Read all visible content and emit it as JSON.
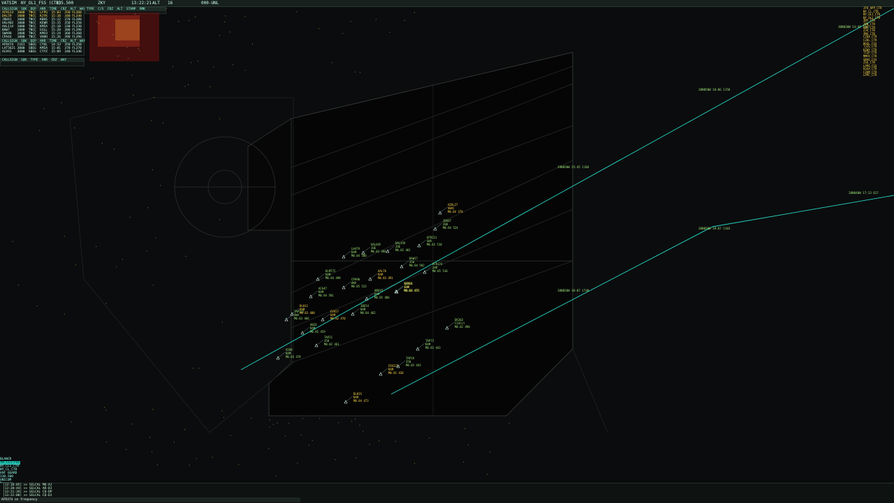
{
  "topbar": {
    "menu": "VATSIM",
    "profile": "NY_OL1_FSS (CTR)",
    "frequency": "135.500",
    "airport": "ZKY",
    "clock": "13:22:21",
    "range": "16",
    "vis": "000-UNL",
    "alt": "ALT"
  },
  "panels": {
    "departures": {
      "title": "CALLSIGN  SQK  DEP  ARR  TIME  CRZ  ALT  WAY",
      "rows": [
        "AFR123  1000  TNCC  LFPG  15:03  350 FL360",
        "DAL59   1000  TNCC  KJFK  15:10  340 FL340",
        "JBU41   1000  TNCC  KBOS  15:12  370 FL380",
        "UAL902  1000  TNCC  KEWR  15:15  350 FL350",
        "AAL114  1000  TNCC  KMIA  15:18  330 FL330",
        "BAW7    1000  TNCC  EGLL  15:20  380 FL390",
        "SWA88   1000  TNCC  KMCO  15:24  360 FL360",
        "CPA44   1000  TNCC  VHHH  15:26  390 FL390"
      ]
    },
    "arrivals": {
      "title": "CALLSIGN  SQK  DEP  ARR  TIME  CRZ  ALT  WAY",
      "rows": [
        "AFR474  2161  SBEG  CYUL  14:33  350 FL350",
        "LAT5621 3000  SBEG  KMIA  15:01  370 FL370",
        "ACA91   3000  SBEG  CYYZ  15:09  340 FL340"
      ]
    },
    "sector": {
      "title": "CALLSIGN  SQK  TYPE  ARR  CRZ  WAY",
      "rows": []
    },
    "metar": {
      "title": "TYPE  C/S  CRZ  ALT  STAMP  RMK",
      "rows": []
    }
  },
  "status": {
    "line1": "BLANCR",
    "line2": "NY_CL1_FSS",
    "line3": "NY_CL1_CTR",
    "line4": "NY_CL_CTR",
    "line5": "VHF GUARD",
    "line6": "130.500",
    "line7": "UNICOM",
    "line8": "Message"
  },
  "chat": {
    "lines": [
      "[13:18:05] >> SELCAL MQ-AJ",
      "[13:20:44] >> SELCAL AK-DJ",
      "[13:21:34] >> SELCAL CQ-DP",
      "[13:22:00] >> SELCAL CQ-DJ"
    ],
    "input": "AFR374 on frequency"
  },
  "freqlist": [
    "JFK_APP_CTR",
    "NY_CL_CTR",
    "NY_OL1_CTR",
    "NY_OL2_CTR",
    "ZNY_CTR",
    "ZBW_CTR",
    "ZDC_CTR",
    "ZJX_CTR",
    "ZMA_CTR",
    "CZQX_CTR",
    "CZUL_CTR",
    "BGGL_FSS",
    "TJZS_CTR",
    "KZWY_CTR",
    "TTZP_CTR",
    "MMFR_CTR",
    "SBAO_FSS",
    "ZSU_CTR",
    "LPPO_FSS",
    "EGGX_CTR",
    "CZQM_CTR",
    "LPPC_CTR"
  ],
  "waypoints": {
    "wp1": "20N050W 18:06 1158",
    "wp2": "19N050W 15:45 1184",
    "wp3": "18N050W 18:07 1748",
    "wp4": "20N050W 18:07 2103",
    "wp5": "20N040W 17:13 627",
    "wp6": "30N030W 14:49 1167"
  },
  "targets": [
    {
      "cs": "AZAL27",
      "info": "VWXC",
      "alt": "M0.84 378",
      "col": "#ffd84a"
    },
    {
      "cs": "AFR211",
      "info": "SWX",
      "alt": "M0.83 510",
      "col": "#9fe67a"
    },
    {
      "cs": "JBU87",
      "info": "Z00",
      "alt": "M0.84 524",
      "col": "#9fe67a"
    },
    {
      "cs": "AFR374",
      "info": "348",
      "alt": "M0.85 510",
      "col": "#9fe67a"
    },
    {
      "cs": "DAL459",
      "info": "JOE",
      "alt": "M0.82 481",
      "col": "#9fe67a"
    },
    {
      "cs": "BAW17",
      "info": "350",
      "alt": "M0.84 502",
      "col": "#9fe67a"
    },
    {
      "cs": "UAL845",
      "info": "JOE",
      "alt": "M0.83 498",
      "col": "#9fe67a"
    },
    {
      "cs": "LH479",
      "info": "RAM",
      "alt": "M0.84 500",
      "col": "#9fe67a"
    },
    {
      "cs": "AAL76",
      "info": "RAM",
      "alt": "M0.83 491",
      "col": "#ffd84a"
    },
    {
      "cs": "CPA90",
      "info": "OWX",
      "alt": "M0.85 533",
      "col": "#9fe67a"
    },
    {
      "cs": "SWA14",
      "info": "JUX",
      "alt": "M0.82 477",
      "col": "#9fe67a"
    },
    {
      "cs": "KLM772",
      "info": "RAM",
      "alt": "M0.84 498",
      "col": "#9fe67a"
    },
    {
      "cs": "DLH11",
      "info": "RAM",
      "alt": "M0.83 480",
      "col": "#ffd84a"
    },
    {
      "cs": "ACA47",
      "info": "RAM",
      "alt": "M0.84 501",
      "col": "#9fe67a"
    },
    {
      "cs": "AMX33",
      "info": "RAM",
      "alt": "M0.85 486",
      "col": "#9fe67a"
    },
    {
      "cs": "EVA57",
      "info": "RAM",
      "alt": "M0.82 470",
      "col": "#ffd84a"
    },
    {
      "cs": "TAP122",
      "info": "OWX",
      "alt": "M0.83 466",
      "col": "#9fe67a"
    },
    {
      "cs": "IBE54",
      "info": "RAM",
      "alt": "M0.84 462",
      "col": "#9fe67a"
    },
    {
      "cs": "ANZ4",
      "info": "RAM",
      "alt": "M0.85 459",
      "col": "#9fe67a"
    },
    {
      "cs": "TAP21",
      "info": "350",
      "alt": "M0.82 461",
      "col": "#9fe67a"
    },
    {
      "cs": "VIR9",
      "info": "RAM",
      "alt": "M0.83 478",
      "col": "#9fe67a"
    },
    {
      "cs": "QTR81",
      "info": "RAM",
      "alt": "M0.84 476",
      "col": "#ffd84a"
    },
    {
      "cs": "EK203",
      "info": "FIXFLY",
      "alt": "M0.82 490",
      "col": "#9fe67a"
    },
    {
      "cs": "TAP73",
      "info": "RAM",
      "alt": "M0.83 443",
      "col": "#9fe67a"
    },
    {
      "cs": "FDX221",
      "info": "RAM",
      "alt": "M0.81 430",
      "col": "#ffd84a"
    },
    {
      "cs": "TAP19",
      "info": "350",
      "alt": "M0.83 443",
      "col": "#9fe67a"
    },
    {
      "cs": "DLH1S",
      "info": "RAM",
      "alt": "M0.84 473",
      "col": "#ffd84a"
    }
  ]
}
